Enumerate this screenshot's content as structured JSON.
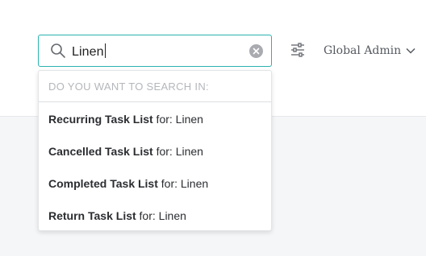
{
  "search": {
    "value": "Linen"
  },
  "header": {
    "user_label": "Global Admin"
  },
  "dropdown": {
    "header": "DO YOU WANT TO SEARCH IN:",
    "items": [
      {
        "name": "Recurring Task List",
        "suffix": " for: Linen"
      },
      {
        "name": "Cancelled Task List",
        "suffix": " for: Linen"
      },
      {
        "name": "Completed Task List",
        "suffix": " for: Linen"
      },
      {
        "name": "Return Task List",
        "suffix": " for: Linen"
      }
    ]
  },
  "colors": {
    "accent": "#29b3b0",
    "background": "#f5f6f8",
    "text": "#2b2d31",
    "muted": "#b4b7bb"
  },
  "icons": {
    "search": "search-icon",
    "clear": "clear-icon",
    "filter": "filter-sliders-icon",
    "dropdown": "chevron-down-icon"
  }
}
